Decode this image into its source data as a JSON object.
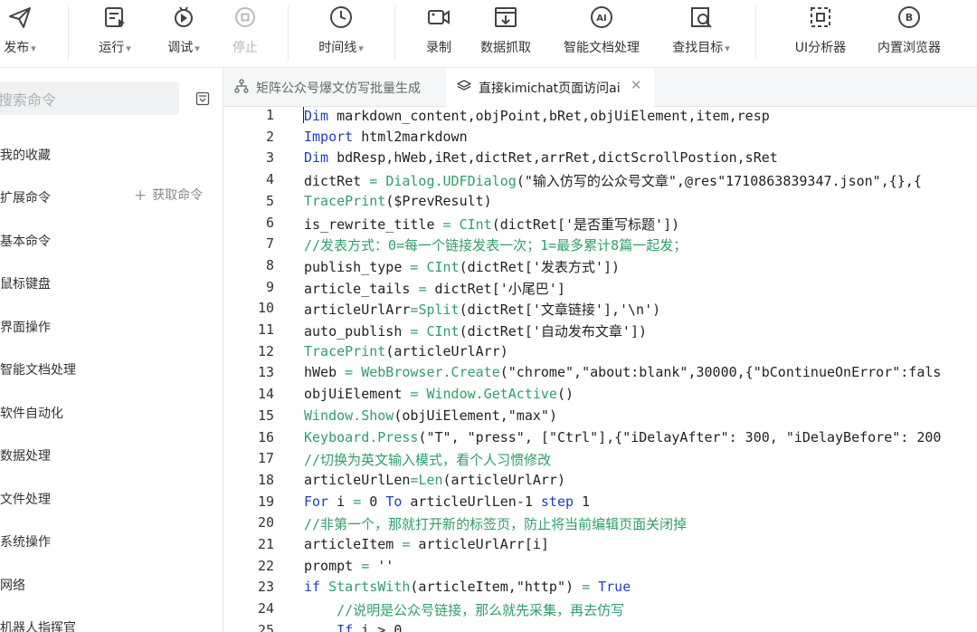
{
  "toolbar": {
    "items": [
      {
        "label": "发布",
        "icon": "send-icon"
      },
      {
        "label": "运行",
        "icon": "run-icon"
      },
      {
        "label": "调试",
        "icon": "debug-icon"
      },
      {
        "label": "停止",
        "icon": "stop-icon"
      },
      {
        "label": "时间线",
        "icon": "clock-icon"
      },
      {
        "label": "录制",
        "icon": "record-icon"
      },
      {
        "label": "数据抓取",
        "icon": "data-capture-icon"
      },
      {
        "label": "智能文档处理",
        "icon": "ai-document-icon"
      },
      {
        "label": "查找目标",
        "icon": "find-target-icon"
      },
      {
        "label": "UI分析器",
        "icon": "ui-analyzer-icon"
      },
      {
        "label": "内置浏览器",
        "icon": "builtin-browser-icon"
      }
    ],
    "dropdown_arrow": "▾"
  },
  "sidebar": {
    "search_placeholder": "搜索命令",
    "categories": [
      "我的收藏",
      "扩展命令",
      "基本命令",
      "鼠标键盘",
      "界面操作",
      "智能文档处理",
      "软件自动化",
      "数据处理",
      "文件处理",
      "系统操作",
      "网络",
      "机器人指挥官"
    ],
    "get_command": "获取命令"
  },
  "tabs": [
    {
      "label": "矩阵公众号爆文仿写批量生成",
      "active": false
    },
    {
      "label": "直接kimichat页面访问ai",
      "active": true
    }
  ],
  "editor": {
    "line_numbers": [
      "1",
      "2",
      "3",
      "4",
      "5",
      "6",
      "7",
      "8",
      "9",
      "10",
      "11",
      "12",
      "13",
      "14",
      "15",
      "16",
      "17",
      "18",
      "19",
      "20",
      "21",
      "22",
      "23",
      "24",
      "25"
    ],
    "lines": [
      "Dim markdown_content,objPoint,bRet,objUiElement,item,resp",
      "Import html2markdown",
      "Dim bdResp,hWeb,iRet,dictRet,arrRet,dictScrollPostion,sRet",
      "dictRet = Dialog.UDFDialog(\"输入仿写的公众号文章\",@res\"1710863839347.json\",{},{",
      "TracePrint($PrevResult)",
      "is_rewrite_title = CInt(dictRet['是否重写标题'])",
      "//发表方式：0=每一个链接发表一次；1=最多累计8篇一起发；",
      "publish_type = CInt(dictRet['发表方式'])",
      "article_tails = dictRet['小尾巴']",
      "articleUrlArr=Split(dictRet['文章链接'],'\\n')",
      "auto_publish = CInt(dictRet['自动发布文章'])",
      "TracePrint(articleUrlArr)",
      "hWeb = WebBrowser.Create(\"chrome\",\"about:blank\",30000,{\"bContinueOnError\":fals",
      "objUiElement = Window.GetActive()",
      "Window.Show(objUiElement,\"max\")",
      "Keyboard.Press(\"T\", \"press\", [\"Ctrl\"],{\"iDelayAfter\": 300, \"iDelayBefore\": 200",
      "//切换为英文输入模式，看个人习惯修改",
      "articleUrlLen=Len(articleUrlArr)",
      "For i = 0 To articleUrlLen-1 step 1",
      "//非第一个，那就打开新的标签页，防止将当前编辑页面关闭掉",
      "articleItem = articleUrlArr[i]",
      "prompt = ''",
      "if StartsWith(articleItem,\"http\") = True",
      "    //说明是公众号链接，那么就先采集，再去仿写",
      "    If i > 0"
    ]
  },
  "colors": {
    "keyword": "#1f3fbf",
    "function": "#2f9e6b",
    "comment": "#2f9e6b",
    "tab_bar_bg": "#f5f6f8",
    "search_bg": "#f0f1f3"
  }
}
